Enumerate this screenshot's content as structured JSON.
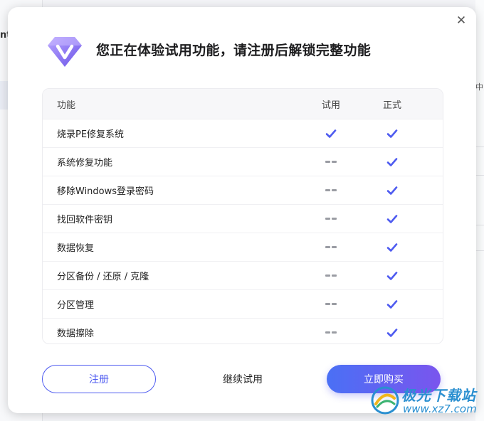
{
  "background": {
    "sidebar_fragment_text": "nt",
    "right_fragment_text": "中,"
  },
  "dialog": {
    "title": "您正在体验试用功能，请注册后解锁完整功能",
    "close_icon": "close-icon",
    "table": {
      "headers": {
        "feature": "功能",
        "trial": "试用",
        "full": "正式"
      },
      "rows": [
        {
          "feature": "烧录PE修复系统",
          "trial": true,
          "full": true
        },
        {
          "feature": "系统修复功能",
          "trial": false,
          "full": true
        },
        {
          "feature": "移除Windows登录密码",
          "trial": false,
          "full": true
        },
        {
          "feature": "找回软件密钥",
          "trial": false,
          "full": true
        },
        {
          "feature": "数据恢复",
          "trial": false,
          "full": true
        },
        {
          "feature": "分区备份 / 还原 / 克隆",
          "trial": false,
          "full": true
        },
        {
          "feature": "分区管理",
          "trial": false,
          "full": true
        },
        {
          "feature": "数据擦除",
          "trial": false,
          "full": true
        }
      ]
    },
    "buttons": {
      "register": "注册",
      "continue_trial": "继续试用",
      "buy_now": "立即购买"
    }
  },
  "watermark": {
    "name": "极光下载站",
    "url": "www.xz7.com"
  },
  "colors": {
    "accent": "#4e5bf0",
    "check": "#4e5bf0",
    "buy_gradient_start": "#4a70f5",
    "buy_gradient_end": "#7a55ee"
  }
}
